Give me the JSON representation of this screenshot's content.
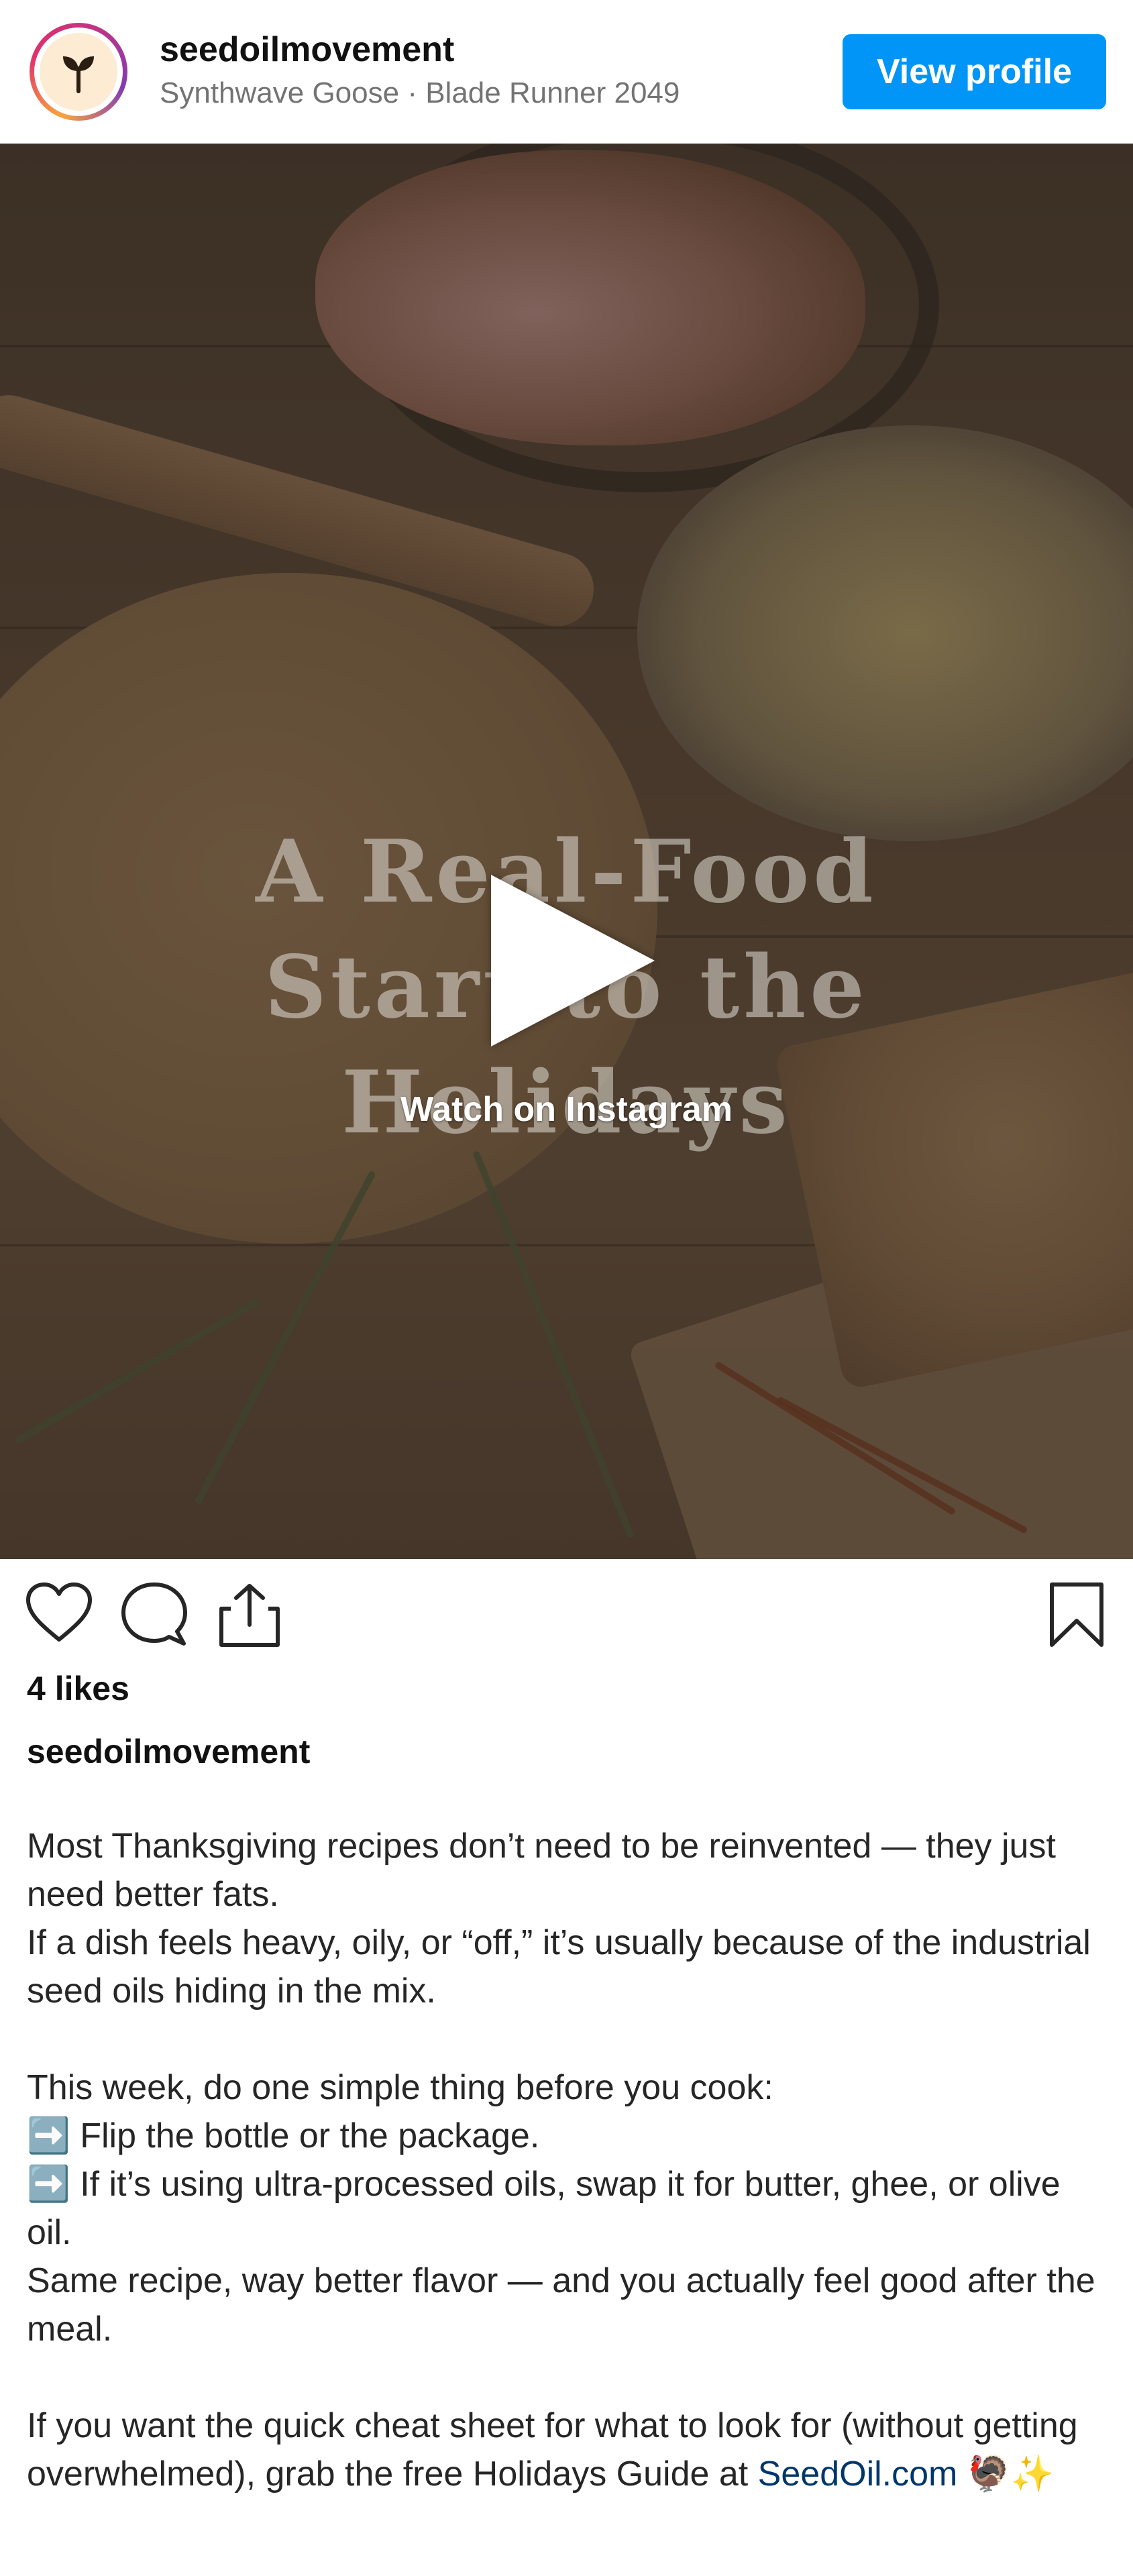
{
  "header": {
    "username": "seedoilmovement",
    "subtitle": "Synthwave Goose · Blade Runner 2049",
    "view_profile_label": "View profile"
  },
  "media": {
    "title_lines": [
      "A Real-Food",
      "Start to the",
      "Holidays"
    ],
    "watch_label": "Watch on Instagram"
  },
  "actions": {
    "icons": [
      "heart-icon",
      "comment-icon",
      "share-icon",
      "bookmark-icon"
    ]
  },
  "post": {
    "likes": "4 likes",
    "caption_username": "seedoilmovement",
    "caption_lines": [
      "Most Thanksgiving recipes don’t need to be reinvented — they just need better fats.",
      "If a dish feels heavy, oily, or “off,” it’s usually because of the industrial seed oils hiding in the mix.",
      "This week, do one simple thing before you cook:",
      "➡️ Flip the bottle or the package.",
      "➡️ If it’s using ultra-processed oils, swap it for butter, ghee, or olive oil.",
      "Same recipe, way better flavor — and you actually feel good after the meal.",
      "If you want the quick cheat sheet for what to look for (without getting overwhelmed), grab the free Holidays Guide at",
      "SeedOil.com",
      "🦃✨"
    ]
  },
  "colors": {
    "accent": "#0095f6",
    "link": "#00376b",
    "text": "#262626",
    "muted": "#737373"
  }
}
